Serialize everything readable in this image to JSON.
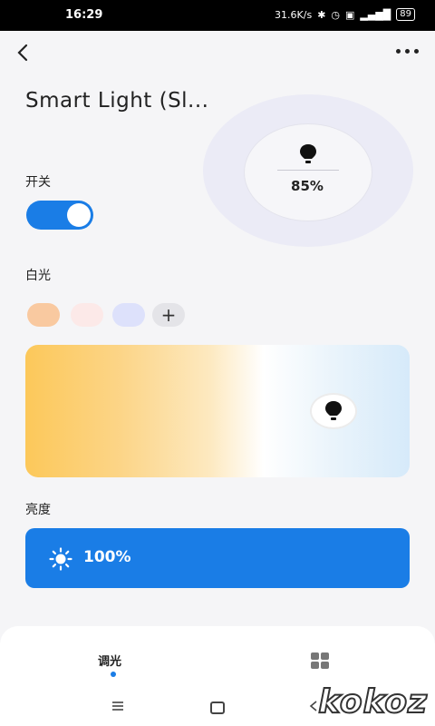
{
  "status_bar": {
    "time": "16:29",
    "network_speed": "31.6K/s",
    "battery": "89",
    "icons": [
      "bluetooth-icon",
      "alarm-icon",
      "hd-icon",
      "5g-signal-icon"
    ]
  },
  "header": {
    "title": "Smart Light (Sl...",
    "back_icon": "chevron-left-icon",
    "more_icon": "more-dots-icon"
  },
  "indicator": {
    "percent": "85%",
    "icon": "bulb-icon"
  },
  "power": {
    "label": "开关",
    "on": true
  },
  "white_light": {
    "label": "白光",
    "swatches": [
      "#f9c9a0",
      "#fce9e8",
      "#dde1fb"
    ],
    "add_label": "+",
    "gradient_colors": [
      "#fcc85a",
      "#ffffff",
      "#d6eafa"
    ]
  },
  "brightness": {
    "label": "亮度",
    "value": "100%",
    "icon": "sun-icon"
  },
  "tabs": {
    "dimming_label": "调光",
    "grid_icon": "grid-icon"
  },
  "watermark": "kokoz",
  "colors": {
    "accent": "#1a7de6",
    "background": "#f5f5f7"
  }
}
